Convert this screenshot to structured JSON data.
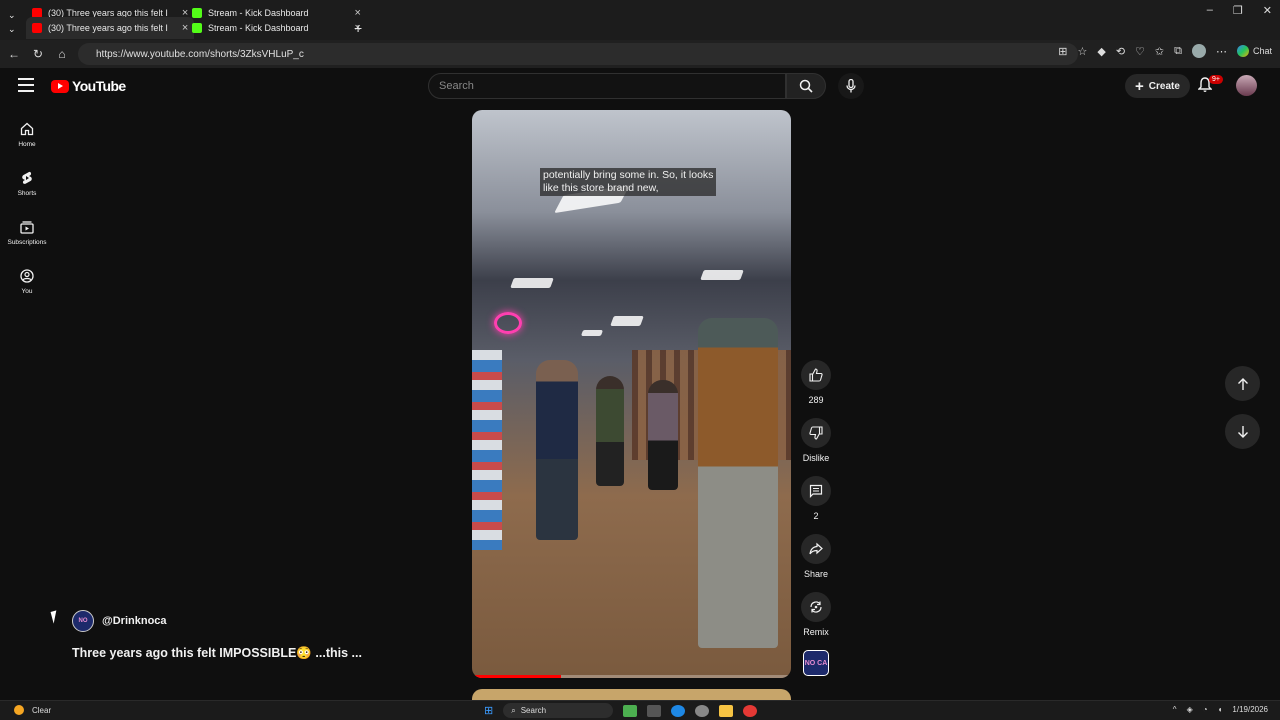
{
  "browser": {
    "tabs": [
      {
        "title": "(30) Three years ago this felt I",
        "active": false
      },
      {
        "title": "Stream - Kick Dashboard",
        "active": false
      },
      {
        "title": "(30) Three years ago this felt I",
        "active": true
      },
      {
        "title": "Stream - Kick Dashboard",
        "active": false
      }
    ],
    "url": "https://www.youtube.com/shorts/3ZksVHLuP_c",
    "chat_label": "Chat"
  },
  "header": {
    "logo_text": "YouTube",
    "search_placeholder": "Search",
    "create_label": "Create",
    "notification_badge": "9+"
  },
  "sidebar": {
    "items": [
      {
        "label": "Home",
        "icon": "home-icon"
      },
      {
        "label": "Shorts",
        "icon": "shorts-icon"
      },
      {
        "label": "Subscriptions",
        "icon": "subscriptions-icon"
      },
      {
        "label": "You",
        "icon": "you-icon"
      }
    ]
  },
  "video": {
    "caption_line1": "potentially bring some in. So, it looks",
    "caption_line2": "like this store brand new,",
    "progress": 0.28
  },
  "actions": {
    "like_count": "289",
    "dislike_label": "Dislike",
    "comment_count": "2",
    "share_label": "Share",
    "remix_label": "Remix",
    "channel_thumb_text": "NO CA"
  },
  "short": {
    "handle": "@Drinknoca",
    "title": "Three years ago this felt IMPOSSIBLE😳 ...this ..."
  },
  "taskbar": {
    "weather": "Clear",
    "search_label": "Search",
    "date": "1/19/2026"
  },
  "colors": {
    "brand_red": "#ff0000",
    "background": "#0f0f0f"
  }
}
